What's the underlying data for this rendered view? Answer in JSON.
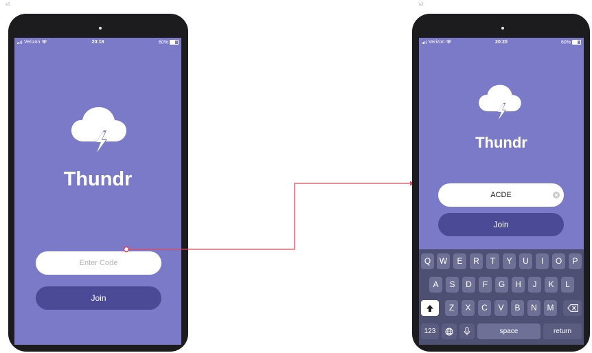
{
  "screens": [
    {
      "tag": "s1",
      "status": {
        "carrier": "Verizon",
        "time": "20:18",
        "battery": "60%"
      },
      "brand": "Thundr",
      "input_placeholder": "Enter Code",
      "join_label": "Join"
    },
    {
      "tag": "s2",
      "status": {
        "carrier": "Verizon",
        "time": "20:20",
        "battery": "60%"
      },
      "brand": "Thundr",
      "input_value": "ACDE",
      "join_label": "Join",
      "keyboard": {
        "row1": [
          "Q",
          "W",
          "E",
          "R",
          "T",
          "Y",
          "U",
          "I",
          "O",
          "P"
        ],
        "row2": [
          "A",
          "S",
          "D",
          "F",
          "G",
          "H",
          "J",
          "K",
          "L"
        ],
        "row3": [
          "Z",
          "X",
          "C",
          "V",
          "B",
          "N",
          "M"
        ],
        "numbers_label": "123",
        "space_label": "space",
        "return_label": "return"
      }
    }
  ],
  "icons": {
    "logo": "cloud-lightning-icon",
    "wifi": "wifi-icon",
    "battery": "battery-icon",
    "shift": "shift-icon",
    "delete": "backspace-icon",
    "globe": "globe-icon",
    "mic": "microphone-icon",
    "clear": "clear-icon"
  },
  "colors": {
    "background": "#7b7ac8",
    "button": "#4a4a96",
    "connector": "#e0475f"
  }
}
